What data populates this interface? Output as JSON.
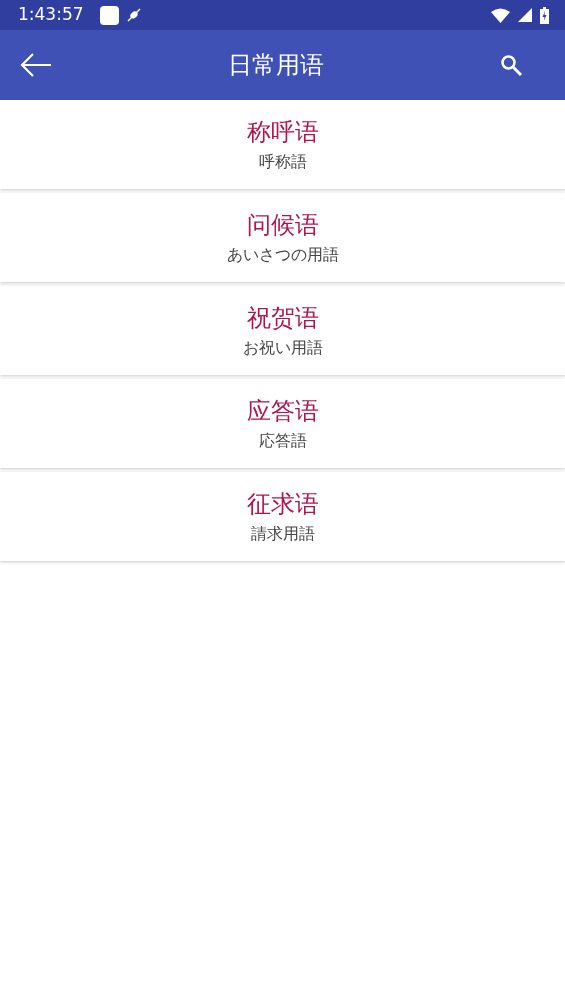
{
  "status_bar": {
    "time": "1:43:57"
  },
  "app_bar": {
    "title": "日常用语"
  },
  "items": [
    {
      "title": "称呼语",
      "subtitle": "呼称語"
    },
    {
      "title": "问候语",
      "subtitle": "あいさつの用語"
    },
    {
      "title": "祝贺语",
      "subtitle": "お祝い用語"
    },
    {
      "title": "应答语",
      "subtitle": "応答語"
    },
    {
      "title": "征求语",
      "subtitle": "請求用語"
    }
  ]
}
